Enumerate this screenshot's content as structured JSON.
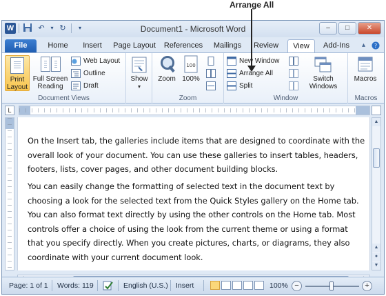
{
  "callout": {
    "label": "Arrange All"
  },
  "window": {
    "title": "Document1 - Microsoft Word",
    "app_icon": "W"
  },
  "title_buttons": {
    "minimize": "–",
    "restore": "□",
    "close": "✕"
  },
  "tabs": [
    {
      "label": "File"
    },
    {
      "label": "Home"
    },
    {
      "label": "Insert"
    },
    {
      "label": "Page Layout"
    },
    {
      "label": "References"
    },
    {
      "label": "Mailings"
    },
    {
      "label": "Review"
    },
    {
      "label": "View"
    },
    {
      "label": "Add-Ins"
    }
  ],
  "active_tab": "View",
  "ribbon": {
    "document_views": {
      "label": "Document Views",
      "print_layout": "Print Layout",
      "full_screen_reading": "Full Screen Reading",
      "web_layout": "Web Layout",
      "outline": "Outline",
      "draft": "Draft"
    },
    "show": {
      "label": "Show"
    },
    "zoom": {
      "label": "Zoom",
      "zoom_button": "Zoom",
      "hundred_percent": "100%"
    },
    "window": {
      "label": "Window",
      "new_window": "New Window",
      "arrange_all": "Arrange All",
      "split": "Split",
      "switch_windows": "Switch Windows"
    },
    "macros": {
      "label": "Macros",
      "macros_button": "Macros"
    }
  },
  "document": {
    "paragraphs": [
      "On the Insert tab, the galleries include items that are designed to coordinate with the overall look of your document. You can use these galleries to insert tables, headers, footers, lists, cover pages, and other document building blocks.",
      "You can easily change the formatting of selected text in the document text by choosing a look for the selected text from the Quick Styles gallery on the Home tab. You can also format text directly by using the other controls on the Home tab. Most controls offer a choice of using the look from the current theme or using a format that you specify directly. When you create pictures, charts, or diagrams, they also coordinate with your current document look."
    ]
  },
  "status_bar": {
    "page": "Page: 1 of 1",
    "words": "Words: 119",
    "language": "English (U.S.)",
    "mode": "Insert",
    "zoom": "100%",
    "zoom_minus": "−",
    "zoom_plus": "+"
  },
  "colors": {
    "accent": "#2b5797",
    "file_tab": "#1f5db2",
    "selected_button": "#f8c54d"
  }
}
